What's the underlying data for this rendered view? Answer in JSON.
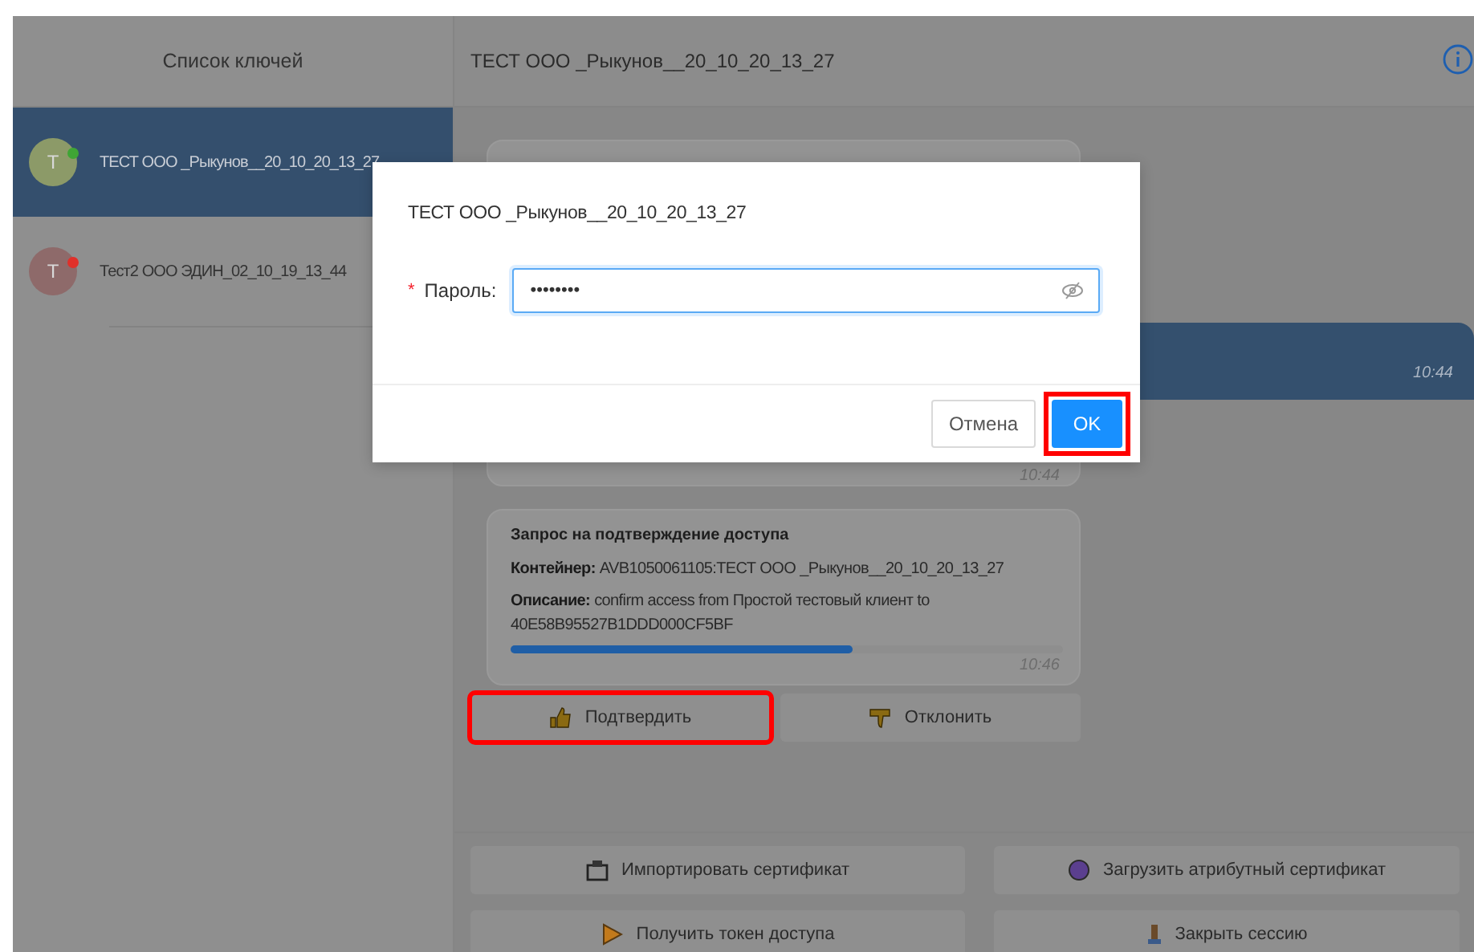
{
  "key_list": {
    "title": "Список ключей",
    "items": [
      {
        "avatar": "T",
        "name": "ТЕСТ ООО _Рыкунов__20_10_20_13_27",
        "color": "#3fa535",
        "selected": true
      },
      {
        "avatar": "T",
        "name": "Тест2 ООО ЭДИН_02_10_19_13_44",
        "color": "#e0302a",
        "selected": false
      }
    ]
  },
  "chat": {
    "title": "ТЕСТ ООО _Рыкунов__20_10_20_13_27",
    "messages": [
      {
        "kind": "incoming",
        "time": "10:44"
      },
      {
        "kind": "outgoing",
        "time": "10:44"
      },
      {
        "kind": "request",
        "title": "Запрос на подтверждение доступа",
        "lines": [
          "**Контейнер:** AVB1050061105:ТЕСТ ООО _Рыкунов__20_10_20_13_27",
          "**Описание:** confirm access from Простой тестовый клиент to 40E58B95527B1DDD000CF5BF"
        ],
        "level": 0.62,
        "time": "10:46"
      }
    ],
    "request_actions": [
      {
        "label": "Подтвердить",
        "highlighted": true
      },
      {
        "label": "Отклонить",
        "highlighted": false
      }
    ],
    "actions": [
      "Импортировать сертификат",
      "Загрузить атрибутный сертификат",
      "Получить токен доступа",
      "Закрыть сессию"
    ]
  },
  "dialog": {
    "title": "ТЕСТ ООО _Рыкунов__20_10_20_13_27",
    "required_mark": "*",
    "field_label": "Пароль:",
    "value": "••••••••",
    "buttons": [
      {
        "label": "Отмена",
        "kind": "default",
        "highlighted": false
      },
      {
        "label": "OK",
        "kind": "primary",
        "highlighted": true
      }
    ]
  }
}
